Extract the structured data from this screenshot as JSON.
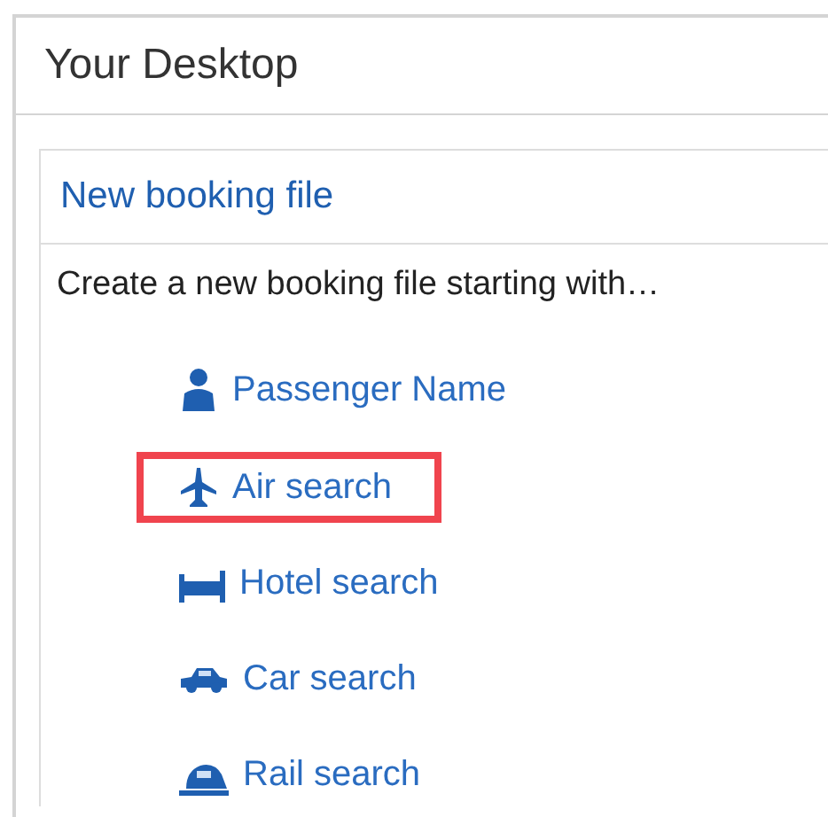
{
  "panel": {
    "title": "Your Desktop"
  },
  "card": {
    "title": "New booking file",
    "intro": "Create a new booking file starting with…",
    "links": [
      {
        "kind": "person",
        "label": "Passenger Name",
        "highlighted": false
      },
      {
        "kind": "plane",
        "label": "Air search",
        "highlighted": true
      },
      {
        "kind": "bed",
        "label": "Hotel search",
        "highlighted": false
      },
      {
        "kind": "car",
        "label": "Car search",
        "highlighted": false
      },
      {
        "kind": "train",
        "label": "Rail search",
        "highlighted": false
      }
    ]
  }
}
